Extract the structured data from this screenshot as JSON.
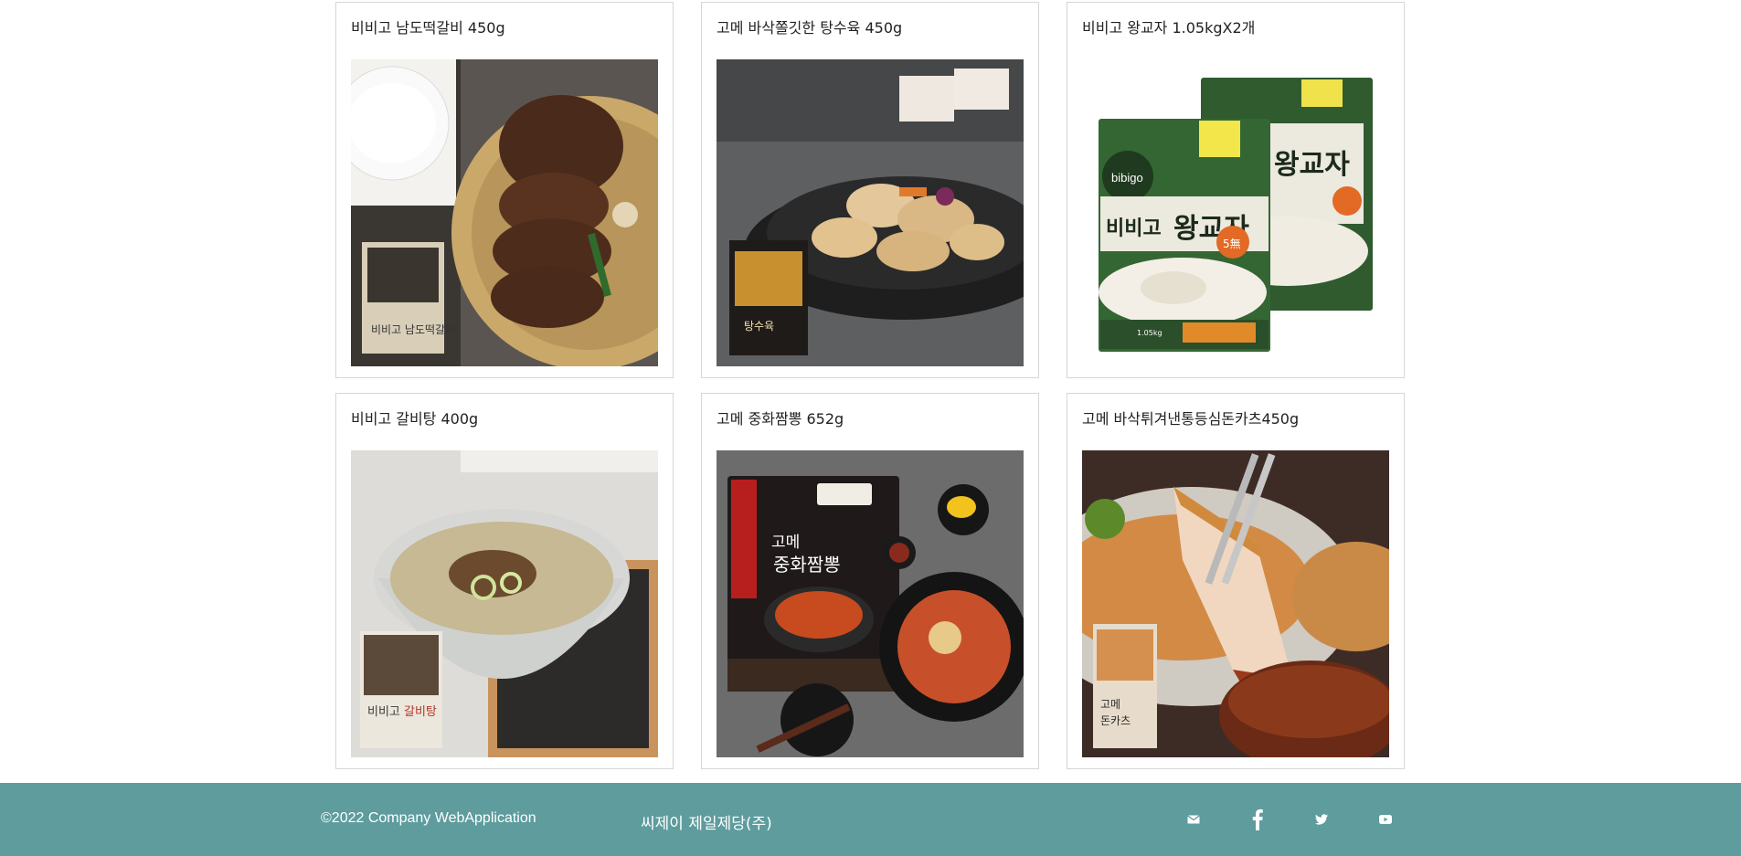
{
  "products": [
    {
      "title": "비비고 남도떡갈비 450g",
      "image": "tteokgalbi-photo"
    },
    {
      "title": "고메 바삭쫄깃한 탕수육 450g",
      "image": "tangsuyuk-photo"
    },
    {
      "title": "비비고 왕교자 1.05kgX2개",
      "image": "wang-gyoza-package-photo",
      "package_text": [
        "비비고",
        "왕교자",
        "bibigo",
        "5無",
        "1.05kg"
      ]
    },
    {
      "title": "비비고 갈비탕 400g",
      "image": "galbitang-photo",
      "package_text": [
        "비비고",
        "갈비탕"
      ]
    },
    {
      "title": "고메 중화짬뽕 652g",
      "image": "jjamppong-photo",
      "package_text": [
        "고메",
        "중화짬뽕"
      ]
    },
    {
      "title": "고메 바삭튀겨낸통등심돈카츠450g",
      "image": "donkatsu-photo",
      "package_text": [
        "고메",
        "돈카츠"
      ]
    }
  ],
  "footer": {
    "copyright": "©2022 Company WebApplication",
    "company": "씨제이 제일제당(주)",
    "social": [
      "mail-icon",
      "facebook-icon",
      "twitter-icon",
      "youtube-icon"
    ]
  },
  "colors": {
    "footer_bg": "#5e9c9e",
    "card_border": "#d6d6d6"
  }
}
